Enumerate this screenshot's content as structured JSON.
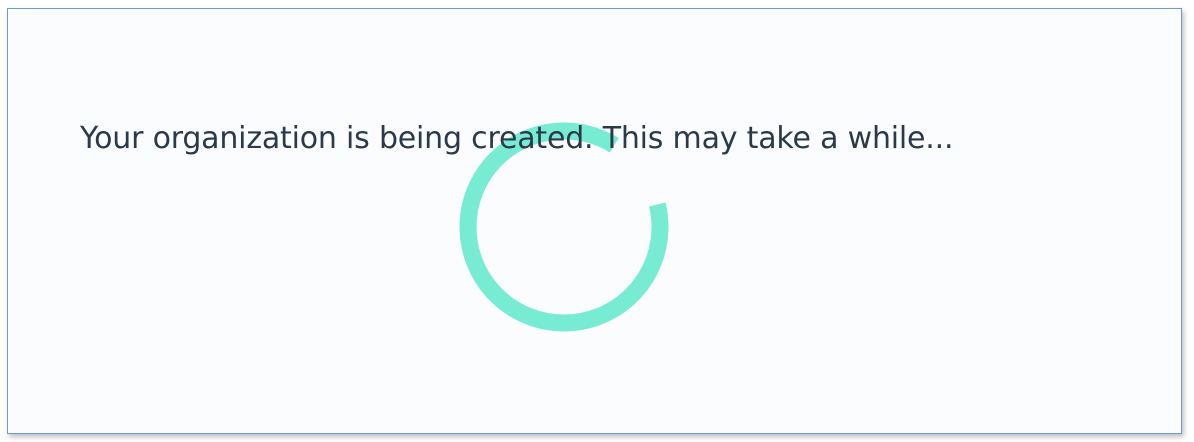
{
  "dialog": {
    "message": "Your organization is being created. This may take a while..."
  },
  "spinner": {
    "icon": "loading-spinner-icon",
    "color": "#78ecd3"
  },
  "colors": {
    "background": "#fbfcfe",
    "border": "#6b9bd1",
    "text": "#2b3a4b"
  }
}
